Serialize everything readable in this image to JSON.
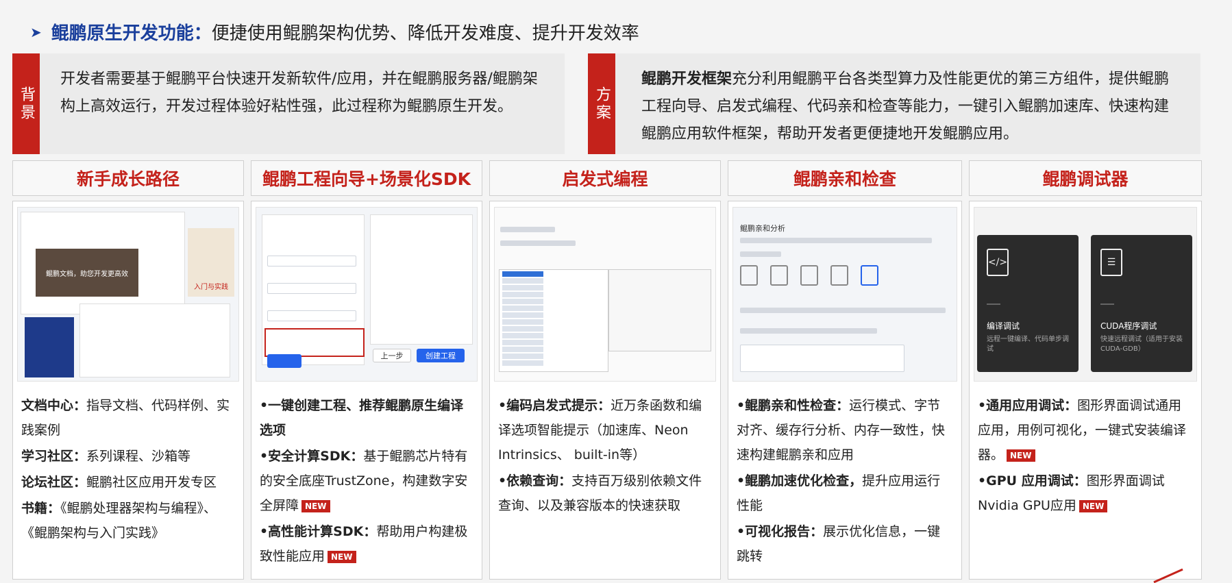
{
  "headline": {
    "arrow": "➤",
    "strong": "鲲鹏原生开发功能：",
    "rest": "便捷使用鲲鹏架构优势、降低开发难度、提升开发效率"
  },
  "background": {
    "tag": "背景",
    "text": "开发者需要基于鲲鹏平台快速开发新软件/应用，并在鲲鹏服务器/鲲鹏架构上高效运行，开发过程体验好粘性强，此过程称为鲲鹏原生开发。"
  },
  "plan": {
    "tag": "方案",
    "strong": "鲲鹏开发框架",
    "text": "充分利用鲲鹏平台各类型算力及性能更优的第三方组件，提供鲲鹏工程向导、启发式编程、代码亲和检查等能力，一键引入鲲鹏加速库、快速构建鲲鹏应用软件框架，帮助开发者更便捷地开发鲲鹏应用。"
  },
  "columns": [
    {
      "title": "新手成长路径",
      "items": [
        {
          "label": "文档中心：",
          "text": "指导文档、代码样例、实践案例",
          "new": false
        },
        {
          "label": "学习社区：",
          "text": "系列课程、沙箱等",
          "new": false
        },
        {
          "label": "论坛社区：",
          "text": "鲲鹏社区应用开发专区",
          "new": false
        },
        {
          "label": "书籍：",
          "text": "《鲲鹏处理器架构与编程》、《鲲鹏架构与入门实践》",
          "new": false
        }
      ]
    },
    {
      "title": "鲲鹏工程向导+场景化SDK",
      "items": [
        {
          "label": "•一键创建工程、推荐鲲鹏原生编译选项",
          "text": "",
          "new": false
        },
        {
          "label": "•安全计算SDK：",
          "text": "基于鲲鹏芯片特有的安全底座TrustZone，构建数字安全屏障",
          "new": true
        },
        {
          "label": "•高性能计算SDK：",
          "text": "帮助用户构建极致性能应用",
          "new": true
        }
      ]
    },
    {
      "title": "启发式编程",
      "items": [
        {
          "label": "•编码启发式提示：",
          "text": "近万条函数和编译选项智能提示（加速库、Neon Intrinsics、 built-in等）",
          "new": false
        },
        {
          "label": "•依赖查询：",
          "text": "支持百万级别依赖文件查询、以及兼容版本的快速获取",
          "new": false
        }
      ]
    },
    {
      "title": "鲲鹏亲和检查",
      "items": [
        {
          "label": "•鲲鹏亲和性检查：",
          "text": "运行模式、字节对齐、缓存行分析、内存一致性，快速构建鲲鹏亲和应用",
          "new": false
        },
        {
          "label": "•鲲鹏加速优化检查，",
          "text": "提升应用运行性能",
          "new": false
        },
        {
          "label": "•可视化报告：",
          "text": "展示优化信息，一键跳转",
          "new": false
        }
      ]
    },
    {
      "title": "鲲鹏调试器",
      "items": [
        {
          "label": "•通用应用调试：",
          "text": "图形界面调试通用应用，用例可视化，一键式安装编译器。",
          "new": true
        },
        {
          "label": "•GPU 应用调试：",
          "text": "图形界面调试Nvidia GPU应用",
          "new": true
        }
      ]
    }
  ],
  "new_label": "NEW",
  "screens": {
    "col1_banner": "鲲鹏文档，助您开发更高效",
    "col1_book": "入门与实践",
    "col2_btn_prev": "上一步",
    "col2_btn_create": "创建工程",
    "col4_title": "鲲鹏亲和分析",
    "col5_card1_title": "编译调试",
    "col5_card1_desc": "远程一键编译、代码单步调试",
    "col5_card2_title": "CUDA程序调试",
    "col5_card2_desc": "快速远程调试（适用于安装CUDA-GDB）"
  },
  "colors": {
    "accent": "#c4221b",
    "headline_blue": "#1a3f9c"
  }
}
